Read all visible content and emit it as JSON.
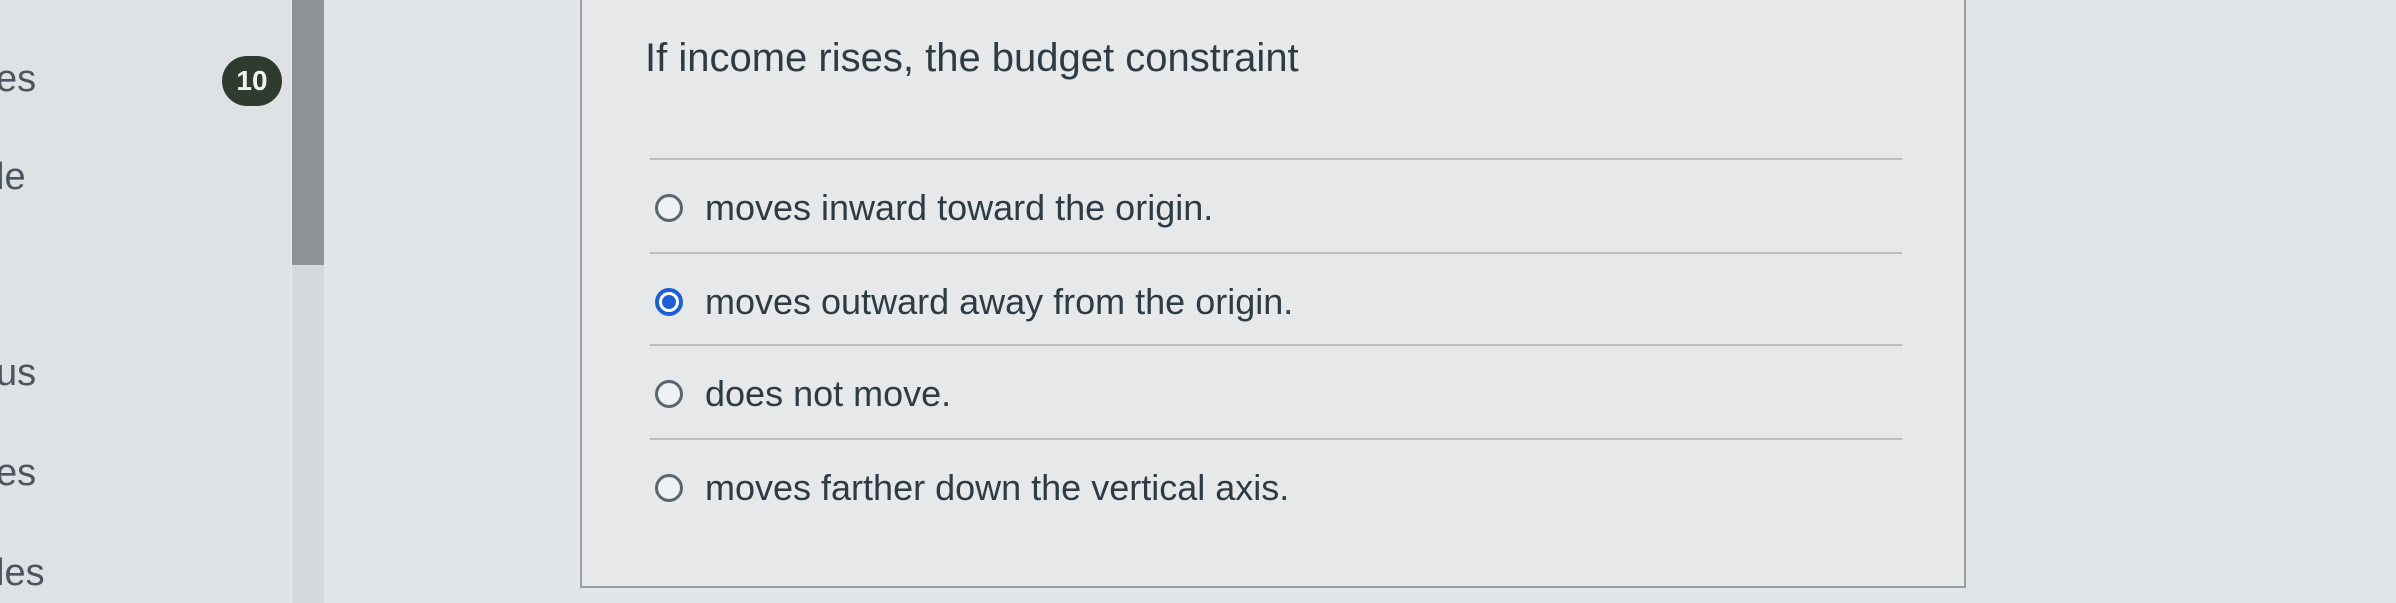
{
  "sidebar": {
    "items": [
      {
        "label": "es"
      },
      {
        "label": "le"
      },
      {
        "label": "us"
      },
      {
        "label": "es"
      },
      {
        "label": "les"
      }
    ]
  },
  "question": {
    "number": "10",
    "prompt": "If income rises, the budget constraint",
    "answers": [
      {
        "label": "moves inward toward the origin.",
        "selected": false
      },
      {
        "label": "moves outward away from the origin.",
        "selected": true
      },
      {
        "label": "does not move.",
        "selected": false
      },
      {
        "label": "moves farther down the vertical axis.",
        "selected": false
      }
    ]
  },
  "colors": {
    "selected_radio": "#1f5fd6",
    "badge_background": "#2f3b2f"
  }
}
